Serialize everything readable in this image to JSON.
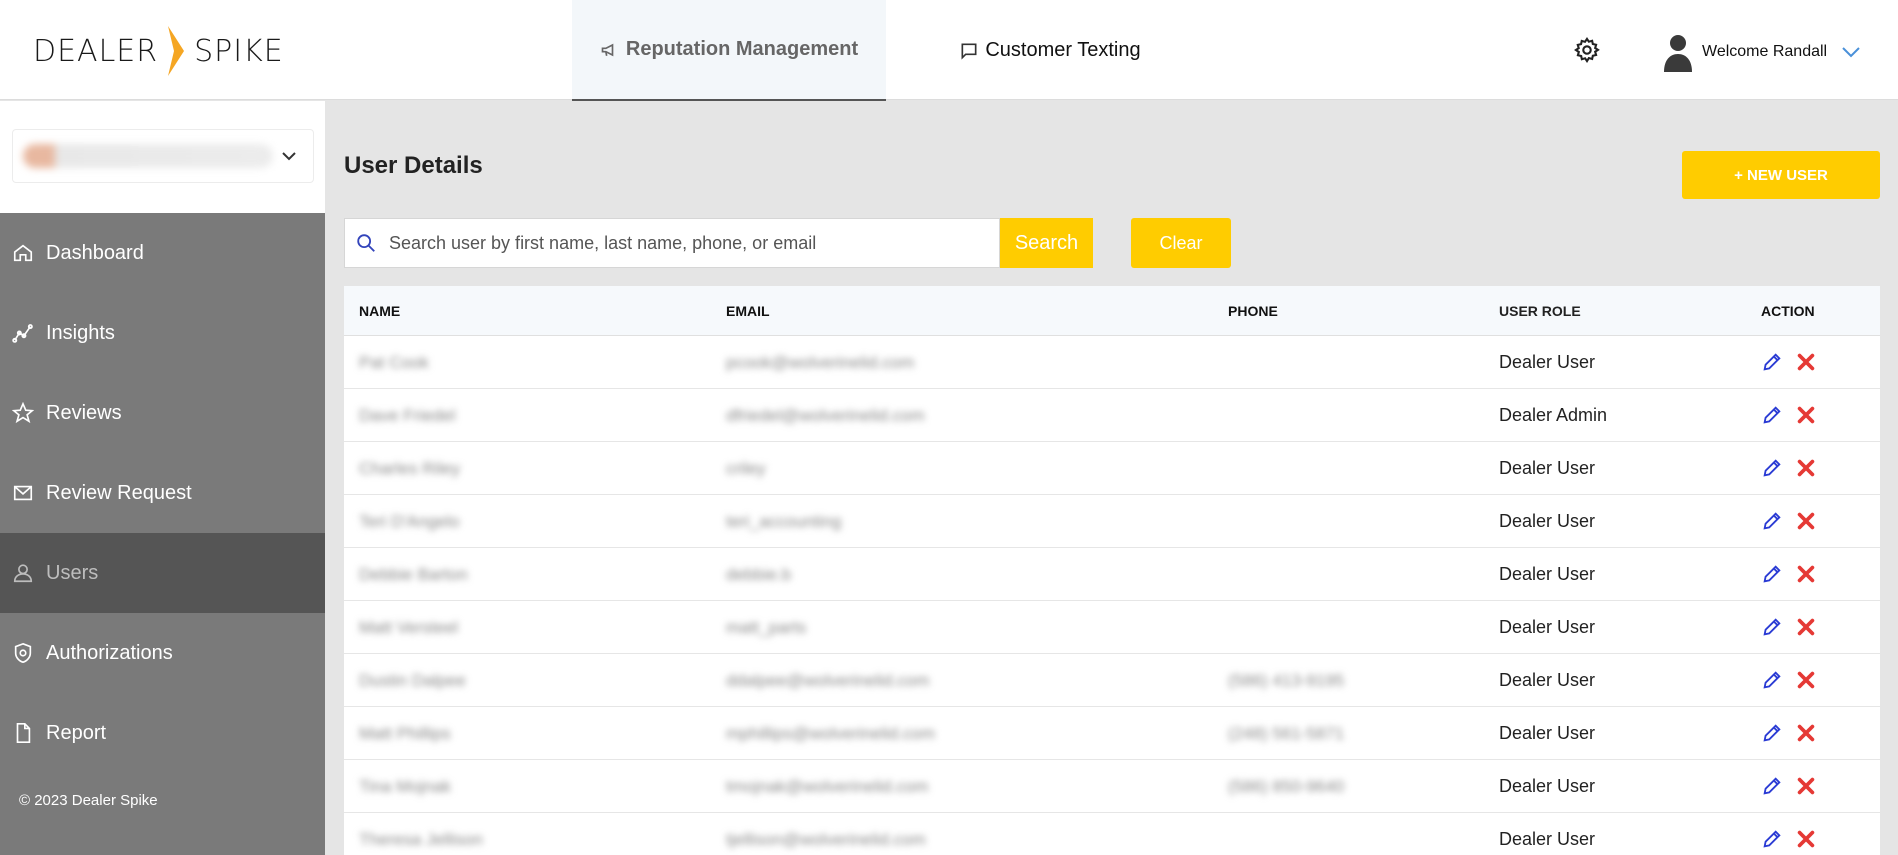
{
  "brand": {
    "left": "DEALER",
    "right": "SPIKE",
    "accent": "#f5a623"
  },
  "header": {
    "tabs": [
      {
        "label": "Reputation Management",
        "icon": "megaphone-icon",
        "active": true
      },
      {
        "label": "Customer Texting",
        "icon": "chat-bubble-icon",
        "active": false
      }
    ],
    "settings_icon": "gear-icon",
    "welcome": "Welcome Randall"
  },
  "sidebar": {
    "items": [
      {
        "label": "Dashboard",
        "icon": "home-icon"
      },
      {
        "label": "Insights",
        "icon": "chart-icon"
      },
      {
        "label": "Reviews",
        "icon": "star-icon"
      },
      {
        "label": "Review Request",
        "icon": "mail-icon"
      },
      {
        "label": "Users",
        "icon": "user-icon",
        "selected": true
      },
      {
        "label": "Authorizations",
        "icon": "shield-icon"
      },
      {
        "label": "Report",
        "icon": "document-icon"
      }
    ],
    "copyright": "© 2023 Dealer Spike"
  },
  "main": {
    "title": "User Details",
    "new_user_label": "+ NEW USER",
    "search": {
      "placeholder": "Search user by first name, last name, phone, or email",
      "value": ""
    },
    "search_label": "Search",
    "clear_label": "Clear",
    "columns": [
      "NAME",
      "EMAIL",
      "PHONE",
      "USER ROLE",
      "ACTION"
    ],
    "rows": [
      {
        "name": "Pat Cook",
        "email": "pcook@wolverinelid.com",
        "phone": "",
        "role": "Dealer User"
      },
      {
        "name": "Dave Friedel",
        "email": "dfriedel@wolverinelid.com",
        "phone": "",
        "role": "Dealer Admin"
      },
      {
        "name": "Charles Riley",
        "email": "criley",
        "phone": "",
        "role": "Dealer User"
      },
      {
        "name": "Teri D'Angelo",
        "email": "teri_accounting",
        "phone": "",
        "role": "Dealer User"
      },
      {
        "name": "Debbie Barton",
        "email": "debbie.b",
        "phone": "",
        "role": "Dealer User"
      },
      {
        "name": "Matt Versteel",
        "email": "matt_parts",
        "phone": "",
        "role": "Dealer User"
      },
      {
        "name": "Dustin Dalpee",
        "email": "ddalpee@wolverinelid.com",
        "phone": "(586) 413-9195",
        "role": "Dealer User"
      },
      {
        "name": "Matt Phillips",
        "email": "mphillips@wolverinelid.com",
        "phone": "(248) 561-5871",
        "role": "Dealer User"
      },
      {
        "name": "Tina Mojnak",
        "email": "tmojnak@wolverinelid.com",
        "phone": "(586) 850-9640",
        "role": "Dealer User"
      },
      {
        "name": "Theresa Jellison",
        "email": "tjellison@wolverinelid.com",
        "phone": "",
        "role": "Dealer User"
      }
    ]
  }
}
